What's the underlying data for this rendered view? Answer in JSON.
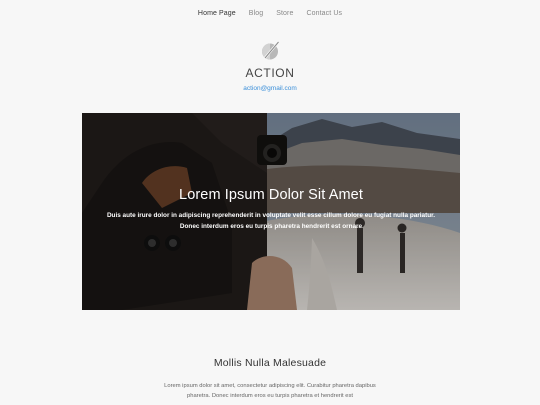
{
  "nav": {
    "items": [
      "Home Page",
      "Blog",
      "Store",
      "Contact Us"
    ]
  },
  "header": {
    "logo_icon": "slash-circle-logo-icon",
    "title": "ACTION",
    "email": "action@gmail.com"
  },
  "hero": {
    "title": "Lorem Ipsum Dolor Sit Amet",
    "text": "Duis aute irure dolor in adipiscing reprehenderit in voluptate velit esse cillum dolore eu fugiat nulla pariatur. Donec interdum eros eu turpis pharetra hendrerit est ornare"
  },
  "section": {
    "title": "Mollis Nulla Malesuade",
    "text": "Lorem ipsum dolor sit amet, consectetur adipiscing elit. Curabitur pharetra dapibus pharetra. Donec interdum eros eu turpis pharetra et hendrerit est"
  },
  "colors": {
    "background": "#f7f7f7",
    "link": "#3b8fd9",
    "nav_active": "#333333",
    "nav_inactive": "#888888"
  }
}
